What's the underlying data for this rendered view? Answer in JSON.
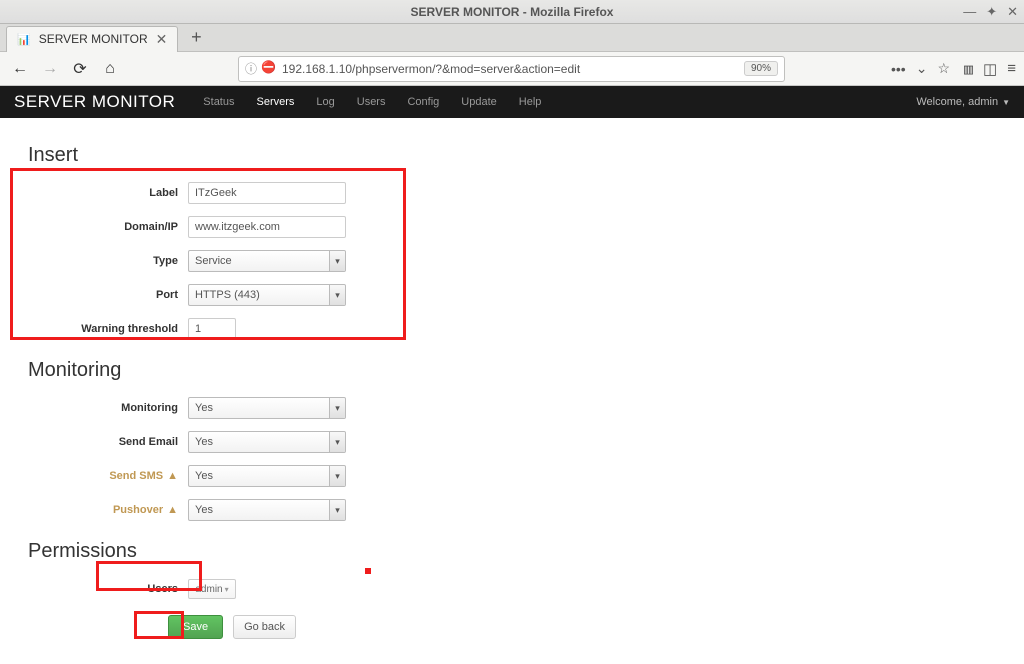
{
  "window": {
    "title": "SERVER MONITOR - Mozilla Firefox"
  },
  "tabs": {
    "active": {
      "label": "SERVER MONITOR"
    }
  },
  "urlbar": {
    "url": "192.168.1.10/phpservermon/?&mod=server&action=edit",
    "zoom": "90%"
  },
  "app": {
    "brand": "SERVER MONITOR",
    "nav": [
      "Status",
      "Servers",
      "Log",
      "Users",
      "Config",
      "Update",
      "Help"
    ],
    "active_nav": "Servers",
    "welcome": "Welcome, admin"
  },
  "sections": {
    "insert": "Insert",
    "monitoring": "Monitoring",
    "permissions": "Permissions"
  },
  "form": {
    "label_label": "Label",
    "label_value": "ITzGeek",
    "domain_label": "Domain/IP",
    "domain_value": "www.itzgeek.com",
    "type_label": "Type",
    "type_value": "Service",
    "port_label": "Port",
    "port_value": "HTTPS (443)",
    "warning_label": "Warning threshold",
    "warning_value": "1",
    "monitoring_label": "Monitoring",
    "monitoring_value": "Yes",
    "sendemail_label": "Send Email",
    "sendemail_value": "Yes",
    "sendsms_label": "Send SMS",
    "sendsms_value": "Yes",
    "pushover_label": "Pushover",
    "pushover_value": "Yes",
    "users_label": "Users",
    "users_value": "admin"
  },
  "buttons": {
    "save": "Save",
    "goback": "Go back"
  }
}
